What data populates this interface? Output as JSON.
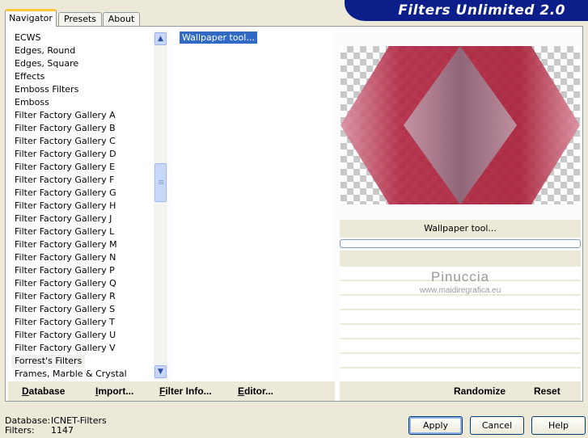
{
  "tabs": [
    {
      "label": "Navigator",
      "active": true
    },
    {
      "label": "Presets",
      "active": false
    },
    {
      "label": "About",
      "active": false
    }
  ],
  "app_title": "Filters Unlimited 2.0",
  "categories": [
    "ECWS",
    "Edges, Round",
    "Edges, Square",
    "Effects",
    "Emboss Filters",
    "Emboss",
    "Filter Factory Gallery A",
    "Filter Factory Gallery B",
    "Filter Factory Gallery C",
    "Filter Factory Gallery D",
    "Filter Factory Gallery E",
    "Filter Factory Gallery F",
    "Filter Factory Gallery G",
    "Filter Factory Gallery H",
    "Filter Factory Gallery J",
    "Filter Factory Gallery L",
    "Filter Factory Gallery M",
    "Filter Factory Gallery N",
    "Filter Factory Gallery P",
    "Filter Factory Gallery Q",
    "Filter Factory Gallery R",
    "Filter Factory Gallery S",
    "Filter Factory Gallery T",
    "Filter Factory Gallery U",
    "Filter Factory Gallery V",
    "Forrest's Filters",
    "Frames, Marble & Crystal"
  ],
  "selected_category": "Forrest's Filters",
  "filters": [
    "Wallpaper tool..."
  ],
  "selected_filter": "Wallpaper tool...",
  "preview": {
    "filter_name": "Wallpaper tool...",
    "progress": 0,
    "colors": {
      "outer": "#b0243f",
      "inner": "#8a6e80"
    }
  },
  "watermark": {
    "name": "Pinuccia",
    "url": "www.maidiregrafica.eu"
  },
  "links_left": [
    {
      "label": "Database",
      "underline": "D"
    },
    {
      "label": "Import...",
      "underline": "I"
    },
    {
      "label": "Filter Info...",
      "underline": "F"
    },
    {
      "label": "Editor...",
      "underline": "E"
    }
  ],
  "links_right": [
    {
      "label": "Randomize"
    },
    {
      "label": "Reset"
    }
  ],
  "info": {
    "database_label": "Database:",
    "database_value": "ICNET-Filters",
    "filters_label": "Filters:",
    "filters_value": "1147"
  },
  "buttons": {
    "apply": "Apply",
    "cancel": "Cancel",
    "help": "Help"
  },
  "icons": {
    "scroll_up": "chevron-up-icon",
    "scroll_down": "chevron-down-icon"
  }
}
